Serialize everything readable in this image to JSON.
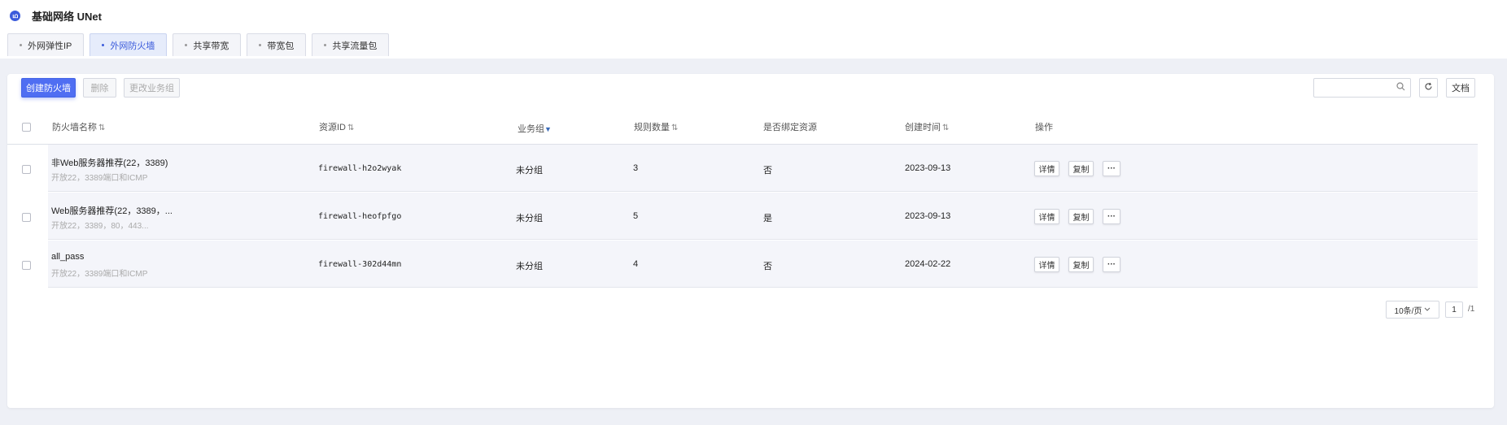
{
  "app": {
    "title": "基础网络 UNet",
    "icon": "network-icon"
  },
  "tabs": [
    {
      "label": "外网弹性IP",
      "active": false
    },
    {
      "label": "外网防火墙",
      "active": true
    },
    {
      "label": "共享带宽",
      "active": false
    },
    {
      "label": "带宽包",
      "active": false
    },
    {
      "label": "共享流量包",
      "active": false
    }
  ],
  "toolbar": {
    "create_label": "创建防火墙",
    "delete_label": "删除",
    "change_group_label": "更改业务组",
    "search_placeholder": "",
    "refresh_icon": "refresh-icon",
    "docs_label": "文档"
  },
  "table": {
    "columns": {
      "name": "防火墙名称",
      "resource_id": "资源ID",
      "group": "业务组",
      "rule_count": "规则数量",
      "bound": "是否绑定资源",
      "created": "创建时间",
      "actions": "操作"
    },
    "rows": [
      {
        "name": "非Web服务器推荐(22，3389)",
        "desc": "开放22，3389端口和ICMP",
        "resource_id": "firewall-h2o2wyak",
        "group": "未分组",
        "rule_count": "3",
        "bound": "否",
        "created": "2023-09-13"
      },
      {
        "name": "Web服务器推荐(22，3389，...",
        "desc": "开放22，3389，80，443...",
        "resource_id": "firewall-heofpfgo",
        "group": "未分组",
        "rule_count": "5",
        "bound": "是",
        "created": "2023-09-13"
      },
      {
        "name": "all_pass",
        "desc": "开放22，3389端口和ICMP",
        "resource_id": "firewall-302d44mn",
        "group": "未分组",
        "rule_count": "4",
        "bound": "否",
        "created": "2024-02-22"
      }
    ],
    "action_labels": {
      "detail": "详情",
      "copy": "复制",
      "more": "···"
    }
  },
  "pagination": {
    "page_size": "10条/页",
    "current_page": "1",
    "total_pages": "/1"
  },
  "colors": {
    "accent": "#4f6ef2",
    "row_bg": "#f4f5fa",
    "page_bg": "#eef0f6"
  }
}
